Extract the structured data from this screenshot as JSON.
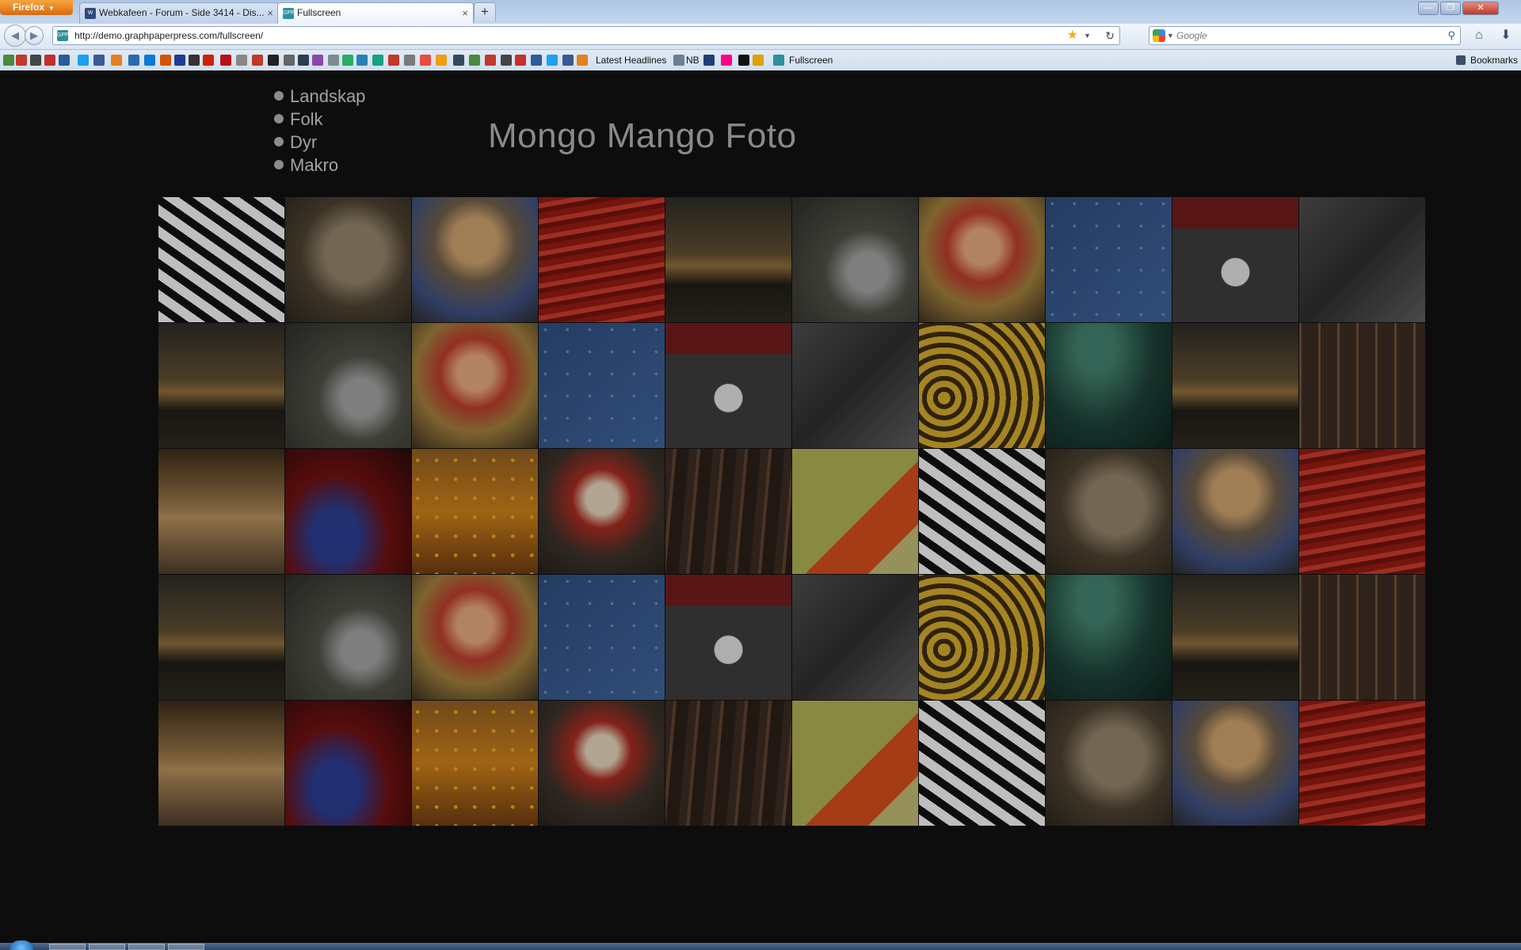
{
  "browser": {
    "menu_label": "Firefox",
    "tabs": [
      {
        "title": "Webkafeen - Forum - Side 3414 - Dis...",
        "favicon": "webkafeen-icon",
        "active": false
      },
      {
        "title": "Fullscreen",
        "favicon": "gpp-icon",
        "active": true
      }
    ],
    "url": "http://demo.graphpaperpress.com/fullscreen/",
    "search_placeholder": "Google",
    "bookmarks_bar": {
      "visible_labels": [
        "Latest Headlines",
        "NB",
        "Fullscreen"
      ],
      "bookmarks_menu_label": "Bookmarks"
    }
  },
  "site": {
    "title": "Mongo Mango Foto",
    "nav": [
      "Landskap",
      "Folk",
      "Dyr",
      "Makro"
    ]
  },
  "gallery": {
    "rows": 5,
    "columns": 10,
    "tiles": [
      "zebra",
      "old-man",
      "blond-boy",
      "red-wall",
      "bmx-sunset",
      "boy-slingshot",
      "doll",
      "blue-pattern",
      "graffiti-child",
      "american-flag",
      "bmx-sunset",
      "boy-slingshot",
      "doll",
      "blue-pattern",
      "graffiti-child",
      "american-flag",
      "yellow-pattern",
      "green-wall",
      "bmx-sunset",
      "three-men",
      "grand-central",
      "red-blur",
      "fruit-market",
      "santa",
      "bike-forest",
      "green-tiles",
      "zebra",
      "old-man",
      "blond-boy",
      "red-wall",
      "bmx-sunset",
      "boy-slingshot",
      "doll",
      "blue-pattern",
      "graffiti-child",
      "american-flag",
      "yellow-pattern",
      "green-wall",
      "bmx-sunset",
      "three-men",
      "grand-central",
      "red-blur",
      "fruit-market",
      "santa",
      "bike-forest",
      "green-tiles",
      "zebra",
      "old-man",
      "blond-boy",
      "red-wall"
    ]
  },
  "colors": {
    "page_background": "#0d0d0d",
    "nav_text": "#a3a3a3",
    "title_text": "#8a8a8a"
  }
}
